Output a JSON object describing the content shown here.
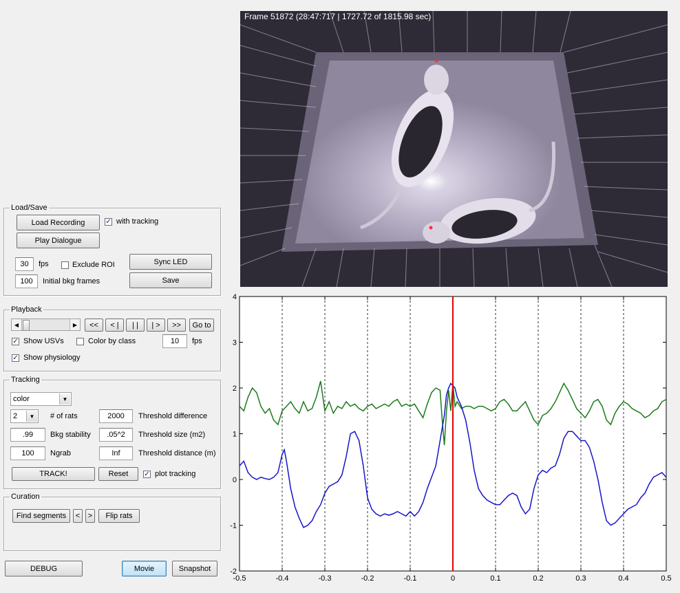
{
  "video": {
    "frame_title": "Frame 51872 (28:47:717 | 1727.72 of 1815.98 sec)"
  },
  "load_save": {
    "legend": "Load/Save",
    "load_recording": "Load Recording",
    "with_tracking": "with tracking",
    "with_tracking_checked": true,
    "play_dialogue": "Play Dialogue",
    "fps_value": "30",
    "fps_label": "fps",
    "exclude_roi": "Exclude ROI",
    "exclude_roi_checked": false,
    "sync_led": "Sync LED",
    "bkg_frames_value": "100",
    "bkg_frames_label": "Initial bkg frames",
    "save": "Save"
  },
  "playback": {
    "legend": "Playback",
    "btn_rewind": "<<",
    "btn_step_back": "< |",
    "btn_pause": "| |",
    "btn_step_fwd": "| >",
    "btn_fast_fwd": ">>",
    "btn_goto": "Go to",
    "show_usvs": "Show USVs",
    "show_usvs_checked": true,
    "color_by_class": "Color by class",
    "color_by_class_checked": false,
    "fps_value": "10",
    "fps_label": "fps",
    "show_physiology": "Show physiology",
    "show_physiology_checked": true
  },
  "tracking": {
    "legend": "Tracking",
    "method": "color",
    "num_rats": "2",
    "num_rats_label": "# of rats",
    "threshold_difference_value": "2000",
    "threshold_difference_label": "Threshold difference",
    "bkg_stability_value": ".99",
    "bkg_stability_label": "Bkg stability",
    "threshold_size_value": ".05^2",
    "threshold_size_label": "Threshold size (m2)",
    "ngrab_value": "100",
    "ngrab_label": "Ngrab",
    "threshold_distance_value": "Inf",
    "threshold_distance_label": "Threshold distance (m)",
    "track": "TRACK!",
    "reset": "Reset",
    "plot_tracking": "plot tracking",
    "plot_tracking_checked": true
  },
  "curation": {
    "legend": "Curation",
    "find_segments": "Find segments",
    "prev": "<",
    "next": ">",
    "flip_rats": "Flip rats"
  },
  "bottom": {
    "debug": "DEBUG",
    "movie": "Movie",
    "snapshot": "Snapshot"
  },
  "chart_data": {
    "type": "line",
    "xlim": [
      -0.5,
      0.5
    ],
    "ylim": [
      -2,
      4
    ],
    "xticks": [
      "-0.5",
      "-0.4",
      "-0.3",
      "-0.2",
      "-0.1",
      "0",
      "0.1",
      "0.2",
      "0.3",
      "0.4",
      "0.5"
    ],
    "yticks": [
      "-2",
      "-1",
      "0",
      "1",
      "2",
      "3",
      "4"
    ],
    "vertical_grid": "dashed at each x tick",
    "cursor_x": 0,
    "cursor_color": "#e00000",
    "series": [
      {
        "color": "#1a7a1a",
        "x": [
          -0.5,
          -0.49,
          -0.48,
          -0.47,
          -0.46,
          -0.45,
          -0.44,
          -0.43,
          -0.42,
          -0.41,
          -0.4,
          -0.39,
          -0.38,
          -0.37,
          -0.36,
          -0.35,
          -0.34,
          -0.33,
          -0.32,
          -0.31,
          -0.3,
          -0.29,
          -0.28,
          -0.27,
          -0.26,
          -0.25,
          -0.24,
          -0.23,
          -0.22,
          -0.21,
          -0.2,
          -0.19,
          -0.18,
          -0.17,
          -0.16,
          -0.15,
          -0.14,
          -0.13,
          -0.12,
          -0.11,
          -0.1,
          -0.09,
          -0.08,
          -0.07,
          -0.06,
          -0.05,
          -0.04,
          -0.03,
          -0.025,
          -0.02,
          -0.015,
          -0.01,
          -0.005,
          0,
          0.005,
          0.01,
          0.02,
          0.03,
          0.04,
          0.05,
          0.06,
          0.07,
          0.08,
          0.09,
          0.1,
          0.11,
          0.12,
          0.13,
          0.14,
          0.15,
          0.16,
          0.17,
          0.18,
          0.19,
          0.2,
          0.21,
          0.22,
          0.23,
          0.24,
          0.25,
          0.26,
          0.27,
          0.28,
          0.29,
          0.3,
          0.31,
          0.32,
          0.33,
          0.34,
          0.35,
          0.36,
          0.37,
          0.38,
          0.39,
          0.4,
          0.41,
          0.42,
          0.43,
          0.44,
          0.45,
          0.46,
          0.47,
          0.48,
          0.49,
          0.5
        ],
        "y": [
          1.6,
          1.5,
          1.8,
          2.0,
          1.9,
          1.6,
          1.45,
          1.55,
          1.3,
          1.2,
          1.5,
          1.6,
          1.7,
          1.55,
          1.45,
          1.7,
          1.5,
          1.55,
          1.8,
          2.15,
          1.5,
          1.7,
          1.45,
          1.6,
          1.55,
          1.7,
          1.6,
          1.65,
          1.55,
          1.5,
          1.6,
          1.65,
          1.55,
          1.6,
          1.65,
          1.6,
          1.7,
          1.75,
          1.6,
          1.65,
          1.6,
          1.65,
          1.5,
          1.35,
          1.65,
          1.9,
          2.0,
          1.95,
          1.3,
          0.75,
          1.5,
          1.95,
          1.5,
          2.1,
          1.6,
          1.7,
          1.55,
          1.6,
          1.6,
          1.55,
          1.6,
          1.6,
          1.55,
          1.5,
          1.55,
          1.7,
          1.75,
          1.65,
          1.5,
          1.5,
          1.6,
          1.7,
          1.5,
          1.3,
          1.2,
          1.4,
          1.45,
          1.55,
          1.7,
          1.9,
          2.1,
          1.95,
          1.75,
          1.55,
          1.45,
          1.35,
          1.5,
          1.7,
          1.75,
          1.6,
          1.3,
          1.2,
          1.45,
          1.6,
          1.7,
          1.65,
          1.55,
          1.5,
          1.45,
          1.35,
          1.4,
          1.5,
          1.55,
          1.7,
          1.75
        ]
      },
      {
        "color": "#1515c8",
        "x": [
          -0.5,
          -0.49,
          -0.48,
          -0.47,
          -0.46,
          -0.45,
          -0.44,
          -0.43,
          -0.42,
          -0.41,
          -0.4,
          -0.395,
          -0.39,
          -0.38,
          -0.37,
          -0.36,
          -0.35,
          -0.34,
          -0.33,
          -0.32,
          -0.31,
          -0.3,
          -0.29,
          -0.28,
          -0.27,
          -0.26,
          -0.25,
          -0.24,
          -0.23,
          -0.22,
          -0.21,
          -0.2,
          -0.19,
          -0.18,
          -0.17,
          -0.16,
          -0.15,
          -0.14,
          -0.13,
          -0.12,
          -0.11,
          -0.1,
          -0.09,
          -0.08,
          -0.07,
          -0.06,
          -0.05,
          -0.04,
          -0.03,
          -0.02,
          -0.015,
          -0.01,
          -0.005,
          0,
          0.005,
          0.01,
          0.02,
          0.03,
          0.04,
          0.05,
          0.06,
          0.07,
          0.08,
          0.09,
          0.1,
          0.11,
          0.12,
          0.13,
          0.14,
          0.15,
          0.16,
          0.17,
          0.18,
          0.19,
          0.2,
          0.21,
          0.22,
          0.23,
          0.24,
          0.25,
          0.26,
          0.27,
          0.28,
          0.29,
          0.3,
          0.31,
          0.32,
          0.33,
          0.34,
          0.35,
          0.36,
          0.37,
          0.38,
          0.39,
          0.4,
          0.41,
          0.42,
          0.43,
          0.44,
          0.45,
          0.46,
          0.47,
          0.48,
          0.49,
          0.5
        ],
        "y": [
          0.3,
          0.4,
          0.15,
          0.05,
          0.0,
          0.05,
          0.02,
          0.0,
          0.05,
          0.15,
          0.55,
          0.65,
          0.4,
          -0.2,
          -0.6,
          -0.85,
          -1.05,
          -1.0,
          -0.9,
          -0.7,
          -0.55,
          -0.3,
          -0.15,
          -0.1,
          -0.05,
          0.1,
          0.5,
          1.0,
          1.05,
          0.85,
          0.3,
          -0.4,
          -0.65,
          -0.75,
          -0.8,
          -0.75,
          -0.78,
          -0.75,
          -0.7,
          -0.75,
          -0.8,
          -0.7,
          -0.8,
          -0.7,
          -0.5,
          -0.2,
          0.05,
          0.3,
          0.85,
          1.4,
          1.85,
          2.0,
          2.1,
          2.05,
          2.0,
          1.8,
          1.6,
          1.3,
          0.8,
          0.2,
          -0.2,
          -0.35,
          -0.45,
          -0.5,
          -0.55,
          -0.55,
          -0.45,
          -0.35,
          -0.3,
          -0.35,
          -0.6,
          -0.75,
          -0.65,
          -0.2,
          0.1,
          0.2,
          0.15,
          0.25,
          0.3,
          0.55,
          0.9,
          1.05,
          1.05,
          0.95,
          0.85,
          0.85,
          0.7,
          0.4,
          0.0,
          -0.5,
          -0.9,
          -1.0,
          -0.95,
          -0.85,
          -0.75,
          -0.65,
          -0.6,
          -0.55,
          -0.4,
          -0.3,
          -0.1,
          0.05,
          0.1,
          0.15,
          0.05
        ]
      }
    ]
  }
}
